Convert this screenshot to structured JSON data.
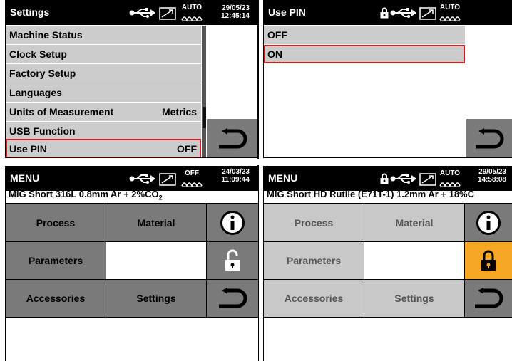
{
  "settings": {
    "title": "Settings",
    "auto": "AUTO",
    "date": "29/05/23",
    "time": "12:45:14",
    "items": [
      {
        "label": "Machine Status",
        "value": ""
      },
      {
        "label": "Clock Setup",
        "value": ""
      },
      {
        "label": "Factory Setup",
        "value": ""
      },
      {
        "label": "Languages",
        "value": ""
      },
      {
        "label": "Units of Measurement",
        "value": "Metrics"
      },
      {
        "label": "USB Function",
        "value": ""
      },
      {
        "label": "Use PIN",
        "value": "OFF"
      }
    ]
  },
  "pin": {
    "title": "Use PIN",
    "auto": "AUTO",
    "options": [
      "OFF",
      "ON"
    ]
  },
  "menu1": {
    "title": "MENU",
    "mode": "OFF",
    "date": "24/03/23",
    "time": "11:09:44",
    "subtitle_main": "MIG Short  316L  0.8mm  Ar + 2%CO",
    "subtitle_sub": "2",
    "buttons": {
      "process": "Process",
      "material": "Material",
      "parameters": "Parameters",
      "accessories": "Accessories",
      "settings": "Settings"
    }
  },
  "menu2": {
    "title": "MENU",
    "mode": "AUTO",
    "date": "29/05/23",
    "time": "14:58:08",
    "subtitle": "MIG Short HD  Rutile (E71T-1)  1.2mm  Ar + 18%C",
    "buttons": {
      "process": "Process",
      "material": "Material",
      "parameters": "Parameters",
      "accessories": "Accessories",
      "settings": "Settings"
    }
  },
  "icons": [
    "usb-icon",
    "arc-icon",
    "wave-icon",
    "lock-icon",
    "unlock-icon",
    "info-icon",
    "back-icon"
  ],
  "colors": {
    "dark_button": "#7a7a7a",
    "light_button": "#c8c8c8",
    "list_row": "#cccccc",
    "highlight": "#d02020",
    "lock_active": "#f5a623"
  }
}
